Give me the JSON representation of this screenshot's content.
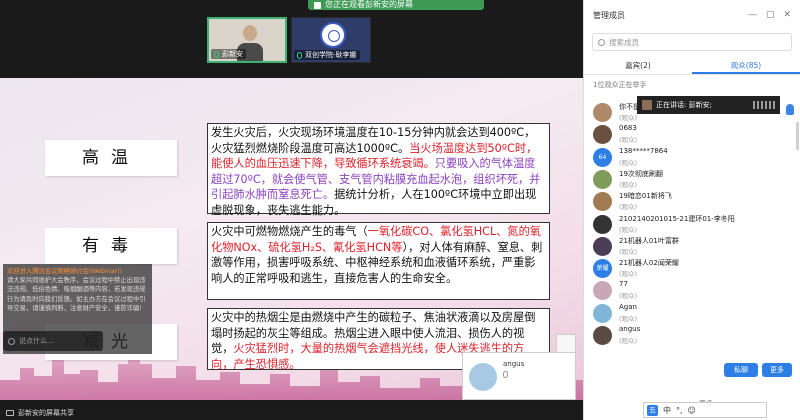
{
  "banner": {
    "text": "您正在观看彭新安的屏幕"
  },
  "video_tiles": [
    {
      "name": "彭新安"
    },
    {
      "name": "双创学院-耿李娜"
    }
  ],
  "slide": {
    "labels": [
      "高温",
      "有毒",
      "减光"
    ],
    "para1": {
      "plain1": "发生火灾后，火灾现场环境温度在10-15分钟内就会达到400ºC，火灾猛烈燃烧阶段温度可高达1000ºC。",
      "red1": "当火场温度达到50ºC时，能使人的血压迅速下降，导致循环系统衰竭。",
      "purple1": "只要吸入的气体温度超过70ºC，就会使气管、支气管内粘膜充血起水泡，组织坏死，并引起肺水肿而窒息死亡。",
      "plain2": "据统计分析，人在100ºC环境中立即出现虚脱现象，丧失逃生能力。"
    },
    "para2": {
      "plain1": "火灾中可燃物燃烧产生的毒气（",
      "red1": "一氧化碳CO、氯化氢HCL、氮的氧化物NOx、硫化氢H₂S、氰化氢HCN等",
      "plain2": "），对人体有麻醉、窒息、刺激等作用，损害呼吸系统、中枢神经系统和血液循环系统，严重影响人的正常呼吸和逃生，直接危害人的生命安全。"
    },
    "para3": {
      "plain1": "火灾中的热烟尘是由燃烧中产生的碳粒子、焦油状液滴以及房屋倒塌时扬起的灰尘等组成。热烟尘进入眼中使人流泪、损伤人的视觉，",
      "red1": "火灾猛烈时，大量的热烟气会遮挡光线，使人迷失逃生的方向，产生恐惧感。"
    }
  },
  "chat_overlay": {
    "title": "欢迎进入腾讯会议网络研讨会(Webinar)!",
    "body": "请大家共同维护大会秩序，会议过程中禁止出现违法违规、低俗色情、吸烟酗酒等内容，若发现违规行为请及时向我们反馈。如主办方在会议过程中引导交易，请谨慎判断，注意财产安全，谨防诈骗!",
    "input_placeholder": "说点什么..."
  },
  "angus_tile": {
    "name": "angus"
  },
  "bottom_bar": {
    "text": "彭新安的屏幕共享"
  },
  "panel": {
    "title": "管理成员",
    "search_placeholder": "搜索成员",
    "tabs": [
      "嘉宾(2)",
      "观众(85)"
    ],
    "hands_up": "1位观众正在举手",
    "speaking": "正在讲话: 彭新安;",
    "members": [
      {
        "name": "你不是",
        "role": "(观众)",
        "avatar_color": "#b08968",
        "avatar_text": ""
      },
      {
        "name": "0683",
        "role": "(观众)",
        "avatar_color": "#6b4f3f",
        "avatar_text": ""
      },
      {
        "name": "138*****7864",
        "role": "(观众)",
        "avatar_color": "#2d7ee5",
        "avatar_text": "64"
      },
      {
        "name": "19次彻底刷翻",
        "role": "(观众)",
        "avatar_color": "#7f9c5a",
        "avatar_text": ""
      },
      {
        "name": "19暗恋01新将飞",
        "role": "(观众)",
        "avatar_color": "#a07b52",
        "avatar_text": ""
      },
      {
        "name": "2102140201015-21建环01-李冬阳",
        "role": "(观众)",
        "avatar_color": "#333333",
        "avatar_text": ""
      },
      {
        "name": "21机器人01叶富群",
        "role": "(观众)",
        "avatar_color": "#4a3d55",
        "avatar_text": ""
      },
      {
        "name": "21机器人02闻荣耀",
        "role": "(观众)",
        "avatar_color": "#2d7ee5",
        "avatar_text": "荣耀"
      },
      {
        "name": "77",
        "role": "(观众)",
        "avatar_color": "#c9a6b8",
        "avatar_text": ""
      },
      {
        "name": "Agan",
        "role": "(观众)",
        "avatar_color": "#7fb6d8",
        "avatar_text": ""
      },
      {
        "name": "angus",
        "role": "(观众)",
        "avatar_color": "#5a4a44",
        "avatar_text": ""
      }
    ],
    "btn_private": "私聊",
    "btn_more": "更多",
    "btn_all_muted": "全员禁言",
    "btn_more2": "更多"
  },
  "ime": {
    "items": [
      "中",
      "°,",
      "☺"
    ]
  }
}
